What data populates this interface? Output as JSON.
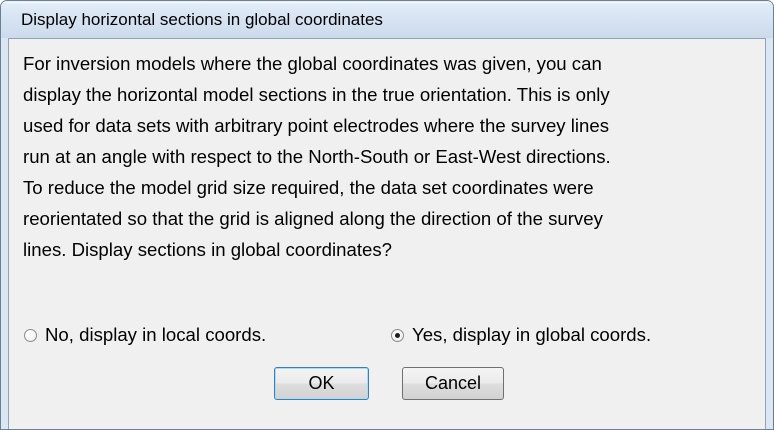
{
  "dialog": {
    "title": "Display horizontal sections in global coordinates",
    "message_lines": [
      "For inversion models where the global coordinates was given, you can",
      "display the horizontal model sections in the true orientation. This is only",
      "used for data sets with arbitrary point electrodes where the survey lines",
      "run at an angle with respect to the North-South or East-West directions.",
      "To reduce the model grid size required, the data set coordinates were",
      "reorientated so that the grid is aligned along the direction of the survey",
      "lines. Display sections in global coordinates?"
    ],
    "options": [
      {
        "label": "No, display in local coords.",
        "selected": false
      },
      {
        "label": "Yes, display in global coords.",
        "selected": true
      }
    ],
    "buttons": {
      "ok_label": "OK",
      "cancel_label": "Cancel"
    }
  },
  "colors": {
    "frame": "#dbe6f3",
    "client_background": "#f0f0f0",
    "default_button_border": "#3c7fb1"
  },
  "icons": {
    "radio_unchecked": "radio-unchecked-icon",
    "radio_checked": "radio-checked-icon"
  }
}
